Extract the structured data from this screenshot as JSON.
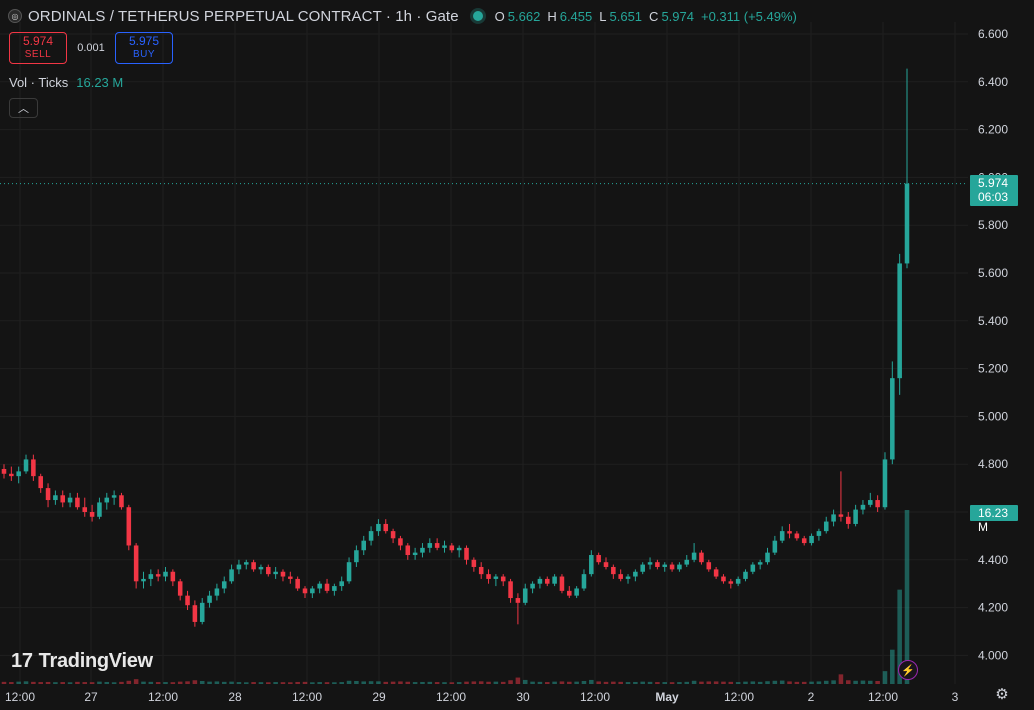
{
  "header": {
    "symbol_icon": "coin-logo-icon",
    "title": "ORDINALS / TETHERUS PERPETUAL CONTRACT · 1h · Gate",
    "status_icon": "market-open-dot",
    "ohlc": {
      "o_label": "O",
      "o": "5.662",
      "h_label": "H",
      "h": "6.455",
      "l_label": "L",
      "l": "5.651",
      "c_label": "C",
      "c": "5.974",
      "change": "+0.311 (+5.49%)"
    }
  },
  "trade": {
    "sell_price": "5.974",
    "sell_label": "SELL",
    "spread": "0.001",
    "buy_price": "5.975",
    "buy_label": "BUY"
  },
  "volume_legend": {
    "label": "Vol · Ticks",
    "value": "16.23 M"
  },
  "collapse_icon": "chevron-up-icon",
  "last_price": {
    "price": "5.974",
    "countdown": "06:03"
  },
  "volume_tag": "16.23 M",
  "branding": "TradingView",
  "colors": {
    "up": "#26a69a",
    "down": "#f23645",
    "background": "#141414",
    "grid": "#1f1f1f"
  },
  "chart_data": {
    "type": "candlestick",
    "timeframe": "1h",
    "y_ticks": [
      "6.600",
      "6.400",
      "6.200",
      "6.000",
      "5.800",
      "5.600",
      "5.400",
      "5.200",
      "5.000",
      "4.800",
      "4.600",
      "4.400",
      "4.200",
      "4.000"
    ],
    "ylim": [
      3.92,
      6.62
    ],
    "x_ticks": [
      "12:00",
      "27",
      "12:00",
      "28",
      "12:00",
      "29",
      "12:00",
      "30",
      "12:00",
      "May",
      "12:00",
      "2",
      "12:00",
      "3"
    ],
    "last_price": 5.974,
    "candles": [
      [
        4.78,
        4.8,
        4.74,
        4.76
      ],
      [
        4.76,
        4.79,
        4.73,
        4.75
      ],
      [
        4.75,
        4.79,
        4.72,
        4.77
      ],
      [
        4.77,
        4.84,
        4.76,
        4.82
      ],
      [
        4.82,
        4.84,
        4.73,
        4.75
      ],
      [
        4.75,
        4.76,
        4.68,
        4.7
      ],
      [
        4.7,
        4.72,
        4.62,
        4.65
      ],
      [
        4.65,
        4.69,
        4.63,
        4.67
      ],
      [
        4.67,
        4.69,
        4.62,
        4.64
      ],
      [
        4.64,
        4.68,
        4.62,
        4.66
      ],
      [
        4.66,
        4.68,
        4.61,
        4.62
      ],
      [
        4.62,
        4.66,
        4.58,
        4.6
      ],
      [
        4.6,
        4.63,
        4.56,
        4.58
      ],
      [
        4.58,
        4.66,
        4.57,
        4.64
      ],
      [
        4.64,
        4.68,
        4.61,
        4.66
      ],
      [
        4.66,
        4.69,
        4.63,
        4.67
      ],
      [
        4.67,
        4.68,
        4.61,
        4.62
      ],
      [
        4.62,
        4.63,
        4.44,
        4.46
      ],
      [
        4.46,
        4.47,
        4.28,
        4.31
      ],
      [
        4.31,
        4.35,
        4.28,
        4.32
      ],
      [
        4.32,
        4.36,
        4.29,
        4.34
      ],
      [
        4.34,
        4.36,
        4.31,
        4.33
      ],
      [
        4.33,
        4.37,
        4.31,
        4.35
      ],
      [
        4.35,
        4.36,
        4.29,
        4.31
      ],
      [
        4.31,
        4.32,
        4.23,
        4.25
      ],
      [
        4.25,
        4.27,
        4.19,
        4.21
      ],
      [
        4.21,
        4.23,
        4.12,
        4.14
      ],
      [
        4.14,
        4.24,
        4.13,
        4.22
      ],
      [
        4.22,
        4.27,
        4.2,
        4.25
      ],
      [
        4.25,
        4.3,
        4.23,
        4.28
      ],
      [
        4.28,
        4.33,
        4.26,
        4.31
      ],
      [
        4.31,
        4.38,
        4.3,
        4.36
      ],
      [
        4.36,
        4.4,
        4.34,
        4.38
      ],
      [
        4.38,
        4.4,
        4.36,
        4.39
      ],
      [
        4.39,
        4.4,
        4.35,
        4.36
      ],
      [
        4.36,
        4.38,
        4.34,
        4.37
      ],
      [
        4.37,
        4.38,
        4.33,
        4.34
      ],
      [
        4.34,
        4.37,
        4.32,
        4.35
      ],
      [
        4.35,
        4.36,
        4.31,
        4.33
      ],
      [
        4.33,
        4.35,
        4.3,
        4.32
      ],
      [
        4.32,
        4.33,
        4.27,
        4.28
      ],
      [
        4.28,
        4.29,
        4.24,
        4.26
      ],
      [
        4.26,
        4.29,
        4.24,
        4.28
      ],
      [
        4.28,
        4.31,
        4.26,
        4.3
      ],
      [
        4.3,
        4.32,
        4.26,
        4.27
      ],
      [
        4.27,
        4.3,
        4.25,
        4.29
      ],
      [
        4.29,
        4.33,
        4.27,
        4.31
      ],
      [
        4.31,
        4.41,
        4.3,
        4.39
      ],
      [
        4.39,
        4.46,
        4.37,
        4.44
      ],
      [
        4.44,
        4.5,
        4.42,
        4.48
      ],
      [
        4.48,
        4.54,
        4.46,
        4.52
      ],
      [
        4.52,
        4.57,
        4.5,
        4.55
      ],
      [
        4.55,
        4.57,
        4.51,
        4.52
      ],
      [
        4.52,
        4.53,
        4.47,
        4.49
      ],
      [
        4.49,
        4.5,
        4.44,
        4.46
      ],
      [
        4.46,
        4.47,
        4.4,
        4.42
      ],
      [
        4.42,
        4.45,
        4.4,
        4.43
      ],
      [
        4.43,
        4.47,
        4.41,
        4.45
      ],
      [
        4.45,
        4.49,
        4.43,
        4.47
      ],
      [
        4.47,
        4.49,
        4.44,
        4.45
      ],
      [
        4.45,
        4.48,
        4.43,
        4.46
      ],
      [
        4.46,
        4.47,
        4.43,
        4.44
      ],
      [
        4.44,
        4.46,
        4.41,
        4.45
      ],
      [
        4.45,
        4.46,
        4.38,
        4.4
      ],
      [
        4.4,
        4.41,
        4.35,
        4.37
      ],
      [
        4.37,
        4.39,
        4.32,
        4.34
      ],
      [
        4.34,
        4.36,
        4.3,
        4.32
      ],
      [
        4.32,
        4.34,
        4.29,
        4.33
      ],
      [
        4.33,
        4.34,
        4.29,
        4.31
      ],
      [
        4.31,
        4.32,
        4.22,
        4.24
      ],
      [
        4.24,
        4.26,
        4.13,
        4.22
      ],
      [
        4.22,
        4.3,
        4.21,
        4.28
      ],
      [
        4.28,
        4.31,
        4.26,
        4.3
      ],
      [
        4.3,
        4.33,
        4.28,
        4.32
      ],
      [
        4.32,
        4.33,
        4.29,
        4.3
      ],
      [
        4.3,
        4.34,
        4.29,
        4.33
      ],
      [
        4.33,
        4.34,
        4.26,
        4.27
      ],
      [
        4.27,
        4.29,
        4.24,
        4.25
      ],
      [
        4.25,
        4.29,
        4.24,
        4.28
      ],
      [
        4.28,
        4.36,
        4.27,
        4.34
      ],
      [
        4.34,
        4.44,
        4.33,
        4.42
      ],
      [
        4.42,
        4.43,
        4.38,
        4.39
      ],
      [
        4.39,
        4.41,
        4.36,
        4.37
      ],
      [
        4.37,
        4.38,
        4.32,
        4.34
      ],
      [
        4.34,
        4.36,
        4.31,
        4.32
      ],
      [
        4.32,
        4.34,
        4.3,
        4.33
      ],
      [
        4.33,
        4.36,
        4.31,
        4.35
      ],
      [
        4.35,
        4.39,
        4.34,
        4.38
      ],
      [
        4.38,
        4.41,
        4.36,
        4.39
      ],
      [
        4.39,
        4.4,
        4.36,
        4.37
      ],
      [
        4.37,
        4.39,
        4.35,
        4.38
      ],
      [
        4.38,
        4.39,
        4.35,
        4.36
      ],
      [
        4.36,
        4.39,
        4.35,
        4.38
      ],
      [
        4.38,
        4.42,
        4.37,
        4.4
      ],
      [
        4.4,
        4.47,
        4.39,
        4.43
      ],
      [
        4.43,
        4.44,
        4.38,
        4.39
      ],
      [
        4.39,
        4.4,
        4.35,
        4.36
      ],
      [
        4.36,
        4.37,
        4.32,
        4.33
      ],
      [
        4.33,
        4.34,
        4.3,
        4.31
      ],
      [
        4.31,
        4.32,
        4.28,
        4.3
      ],
      [
        4.3,
        4.33,
        4.29,
        4.32
      ],
      [
        4.32,
        4.36,
        4.31,
        4.35
      ],
      [
        4.35,
        4.39,
        4.34,
        4.38
      ],
      [
        4.38,
        4.4,
        4.36,
        4.39
      ],
      [
        4.39,
        4.45,
        4.38,
        4.43
      ],
      [
        4.43,
        4.5,
        4.42,
        4.48
      ],
      [
        4.48,
        4.54,
        4.47,
        4.52
      ],
      [
        4.52,
        4.55,
        4.49,
        4.51
      ],
      [
        4.51,
        4.52,
        4.48,
        4.49
      ],
      [
        4.49,
        4.5,
        4.46,
        4.47
      ],
      [
        4.47,
        4.51,
        4.46,
        4.5
      ],
      [
        4.5,
        4.53,
        4.48,
        4.52
      ],
      [
        4.52,
        4.58,
        4.51,
        4.56
      ],
      [
        4.56,
        4.61,
        4.54,
        4.59
      ],
      [
        4.59,
        4.77,
        4.56,
        4.58
      ],
      [
        4.58,
        4.6,
        4.53,
        4.55
      ],
      [
        4.55,
        4.63,
        4.54,
        4.61
      ],
      [
        4.61,
        4.65,
        4.59,
        4.63
      ],
      [
        4.63,
        4.68,
        4.62,
        4.65
      ],
      [
        4.65,
        4.67,
        4.6,
        4.62
      ],
      [
        4.62,
        4.85,
        4.61,
        4.82
      ],
      [
        4.82,
        5.23,
        4.8,
        5.16
      ],
      [
        5.16,
        5.68,
        5.09,
        5.64
      ],
      [
        5.64,
        6.455,
        5.62,
        5.974
      ]
    ],
    "volume_values": [
      0.2,
      0.18,
      0.22,
      0.25,
      0.2,
      0.18,
      0.19,
      0.17,
      0.18,
      0.16,
      0.2,
      0.18,
      0.17,
      0.22,
      0.19,
      0.16,
      0.2,
      0.3,
      0.45,
      0.22,
      0.2,
      0.18,
      0.18,
      0.17,
      0.22,
      0.25,
      0.35,
      0.28,
      0.22,
      0.24,
      0.2,
      0.22,
      0.18,
      0.16,
      0.18,
      0.17,
      0.16,
      0.18,
      0.17,
      0.16,
      0.19,
      0.2,
      0.16,
      0.18,
      0.17,
      0.16,
      0.18,
      0.3,
      0.28,
      0.24,
      0.26,
      0.25,
      0.2,
      0.22,
      0.24,
      0.21,
      0.18,
      0.19,
      0.2,
      0.18,
      0.17,
      0.16,
      0.18,
      0.22,
      0.24,
      0.25,
      0.21,
      0.22,
      0.2,
      0.35,
      0.6,
      0.38,
      0.22,
      0.2,
      0.18,
      0.22,
      0.24,
      0.21,
      0.22,
      0.28,
      0.38,
      0.24,
      0.2,
      0.22,
      0.2,
      0.18,
      0.19,
      0.22,
      0.2,
      0.18,
      0.18,
      0.17,
      0.18,
      0.2,
      0.3,
      0.22,
      0.24,
      0.24,
      0.22,
      0.2,
      0.18,
      0.22,
      0.24,
      0.2,
      0.26,
      0.3,
      0.32,
      0.24,
      0.2,
      0.2,
      0.22,
      0.24,
      0.3,
      0.34,
      0.9,
      0.35,
      0.3,
      0.32,
      0.3,
      0.28,
      1.2,
      3.2,
      8.8,
      16.23
    ],
    "volume_max": 16.23
  }
}
